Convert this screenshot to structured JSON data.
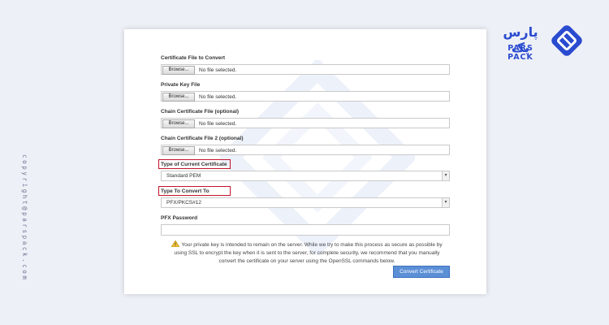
{
  "brand": {
    "name_fa": "پارس پک",
    "name_en": "PARS PACK",
    "copyright": "copyright@parspack.com",
    "accent_color": "#2a4bd0"
  },
  "form": {
    "cert_file": {
      "label": "Certificate File to Convert",
      "browse": "Browse...",
      "status": "No file selected."
    },
    "private_key": {
      "label": "Private Key File",
      "browse": "Browse...",
      "status": "No file selected."
    },
    "chain_cert": {
      "label": "Chain Certificate File (optional)",
      "browse": "Browse...",
      "status": "No file selected."
    },
    "chain_cert_2": {
      "label": "Chain Certificate File 2 (optional)",
      "browse": "Browse...",
      "status": "No file selected."
    },
    "current_type": {
      "label": "Type of Current Certificate",
      "selected": "Standard PEM"
    },
    "convert_to": {
      "label": "Type To Convert To",
      "selected": "PFX/PKCS#12"
    },
    "pfx_password": {
      "label": "PFX Password",
      "value": ""
    },
    "notice_line1": "Your private key is intended to remain on the server. While we try to make this process as secure as possible by",
    "notice_line2": "using SSL to encrypt the key when it is sent to the server, for complete security, we recommend that you manually",
    "notice_line3": "convert the certificate on your server using the OpenSSL commands below.",
    "submit": "Convert Certificate",
    "highlight_color": "#c3122a",
    "button_color": "#5b8fd6",
    "warning_icon": "warning-triangle-icon"
  }
}
